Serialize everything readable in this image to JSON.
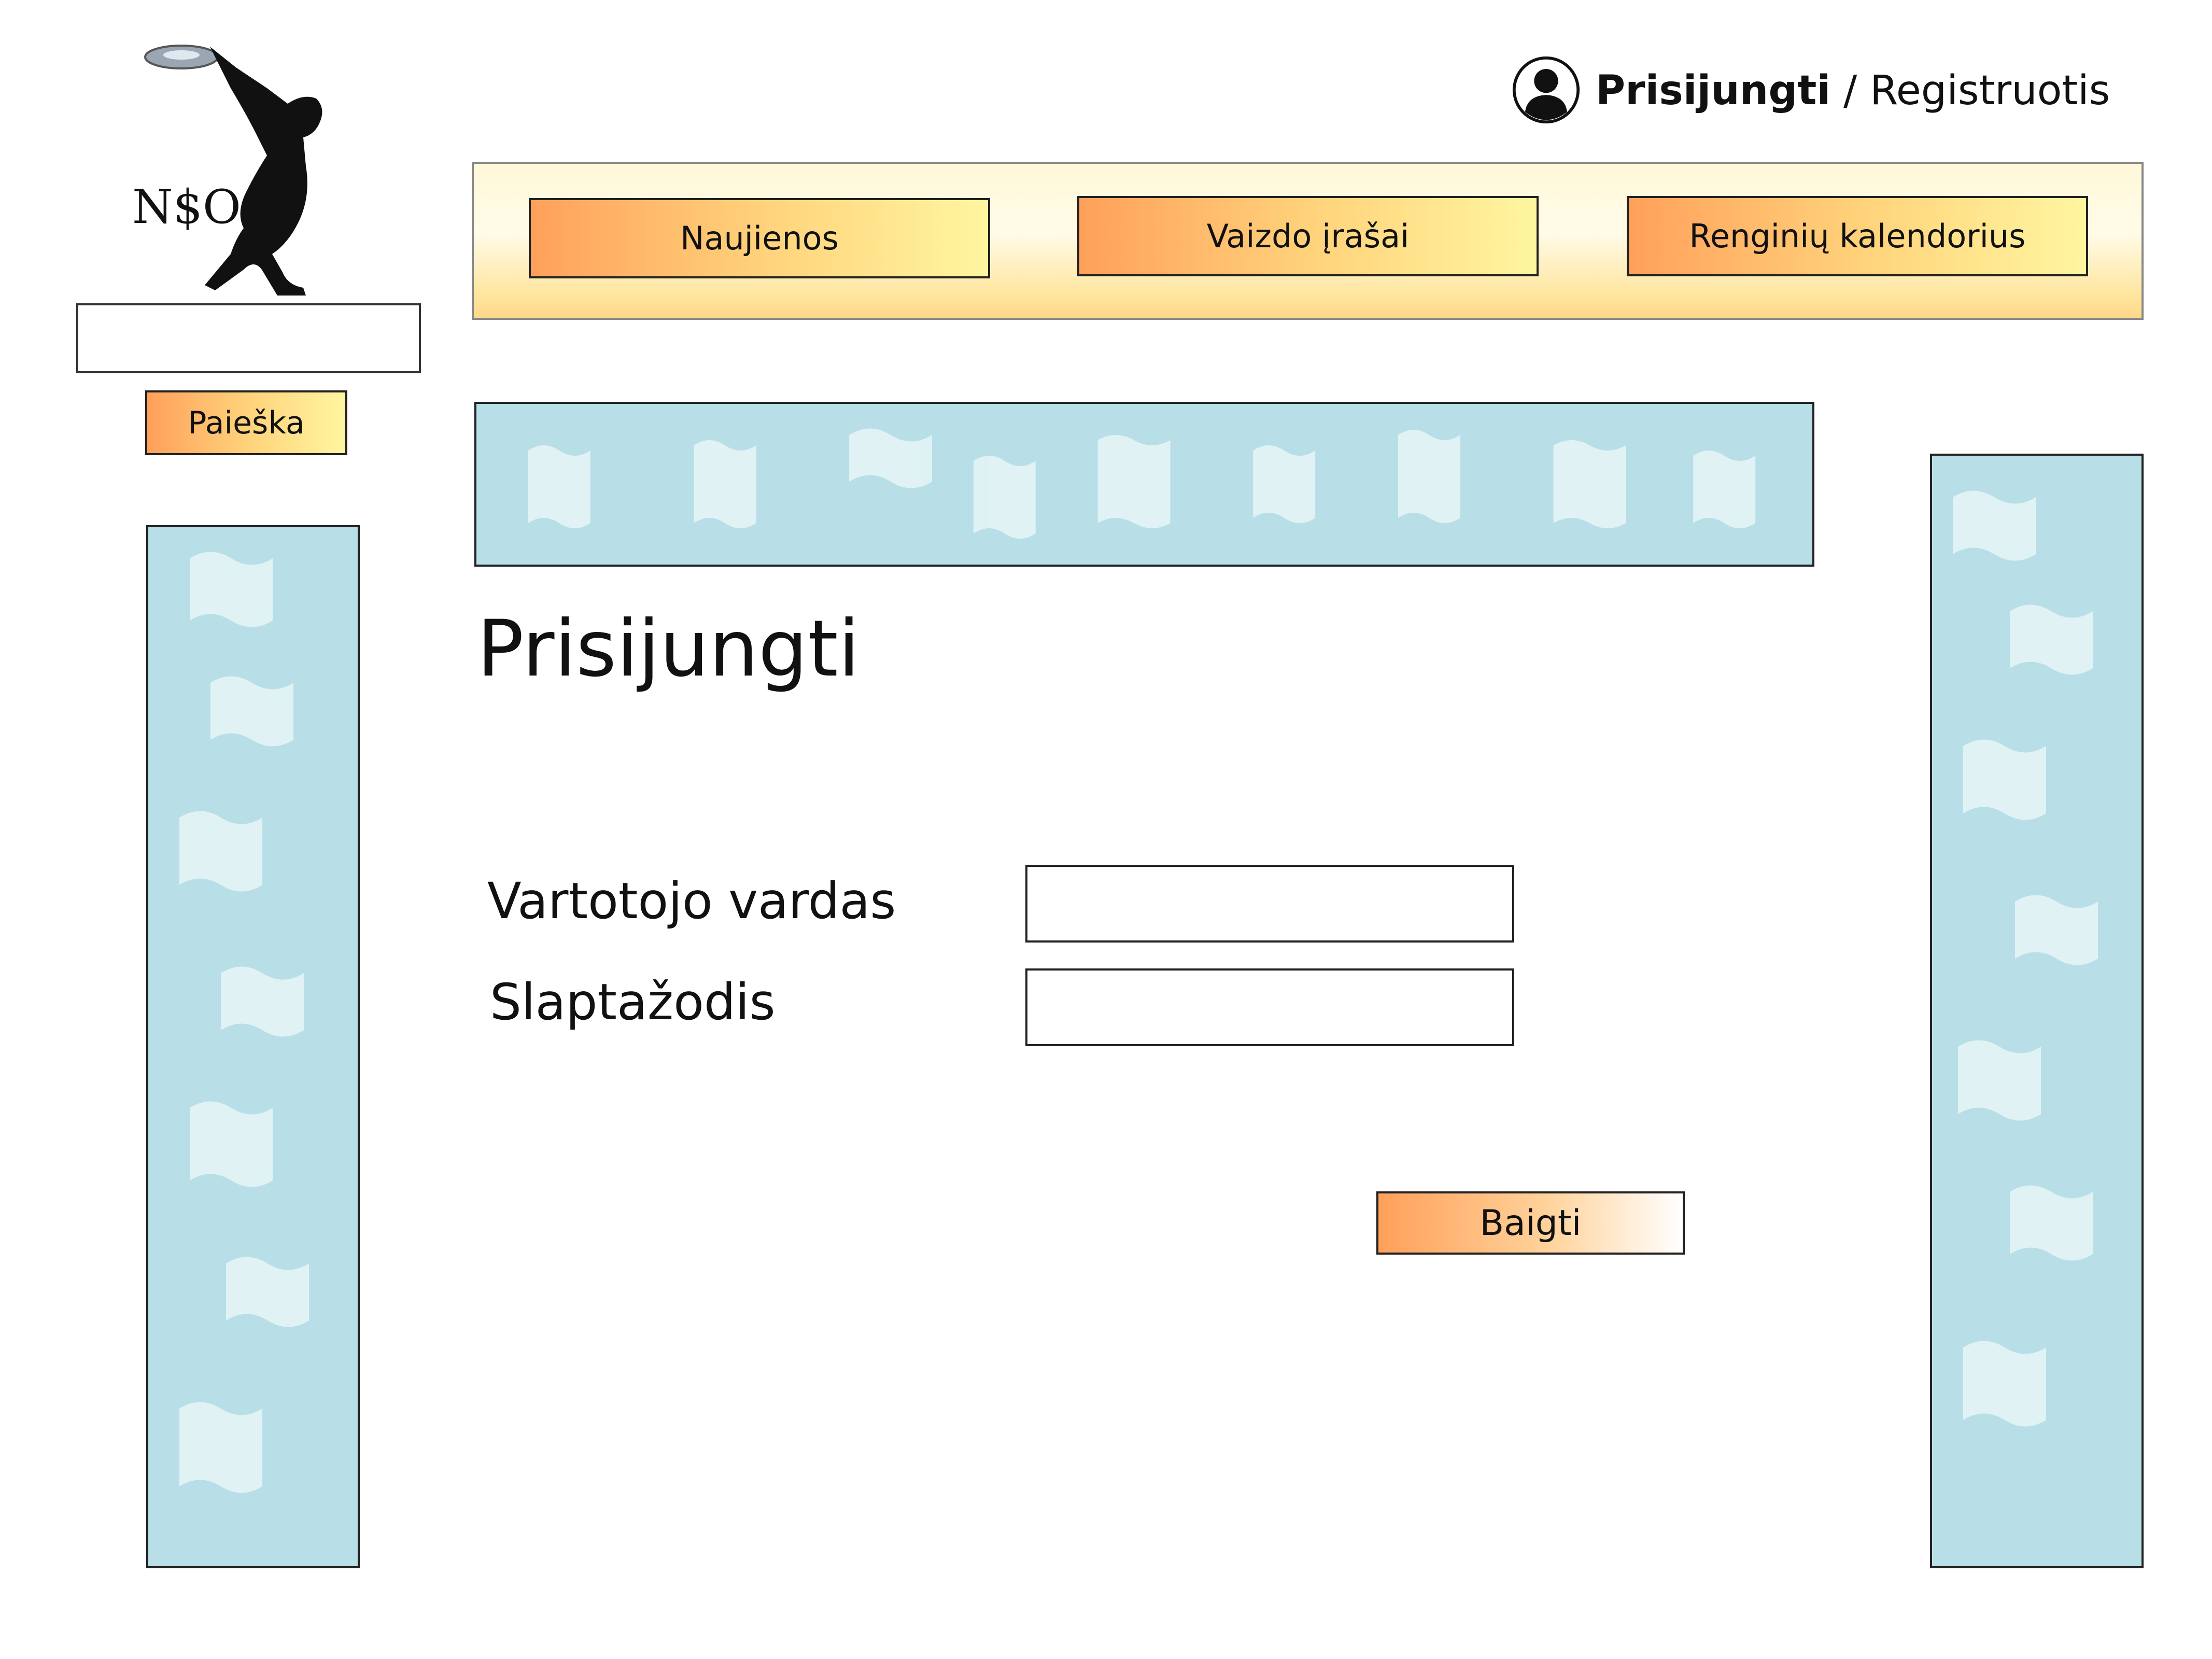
{
  "header": {
    "login_label": "Prisijungti",
    "separator": " / ",
    "register_label": "Registruotis"
  },
  "logo": {
    "text": "N$O"
  },
  "sidebar": {
    "search_placeholder": "",
    "search_button_label": "Paieška"
  },
  "nav": {
    "items": [
      {
        "label": "Naujienos"
      },
      {
        "label": "Vaizdo įrašai"
      },
      {
        "label": "Renginių kalendorius"
      }
    ]
  },
  "form": {
    "title": "Prisijungti",
    "username_label": "Vartotojo vardas",
    "username_value": "",
    "password_label": "Slaptažodis",
    "password_value": "",
    "submit_label": "Baigti"
  },
  "colors": {
    "button_gradient_start": "#ffa05a",
    "button_gradient_end": "#fff6a0",
    "placeholder_fill": "#b8dfe8"
  }
}
